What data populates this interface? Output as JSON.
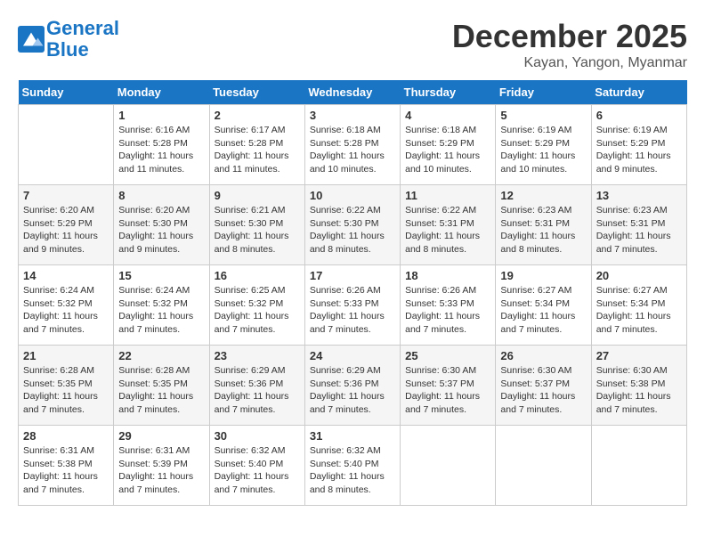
{
  "logo": {
    "line1": "General",
    "line2": "Blue"
  },
  "title": "December 2025",
  "location": "Kayan, Yangon, Myanmar",
  "headers": [
    "Sunday",
    "Monday",
    "Tuesday",
    "Wednesday",
    "Thursday",
    "Friday",
    "Saturday"
  ],
  "weeks": [
    [
      {
        "day": "",
        "info": ""
      },
      {
        "day": "1",
        "info": "Sunrise: 6:16 AM\nSunset: 5:28 PM\nDaylight: 11 hours\nand 11 minutes."
      },
      {
        "day": "2",
        "info": "Sunrise: 6:17 AM\nSunset: 5:28 PM\nDaylight: 11 hours\nand 11 minutes."
      },
      {
        "day": "3",
        "info": "Sunrise: 6:18 AM\nSunset: 5:28 PM\nDaylight: 11 hours\nand 10 minutes."
      },
      {
        "day": "4",
        "info": "Sunrise: 6:18 AM\nSunset: 5:29 PM\nDaylight: 11 hours\nand 10 minutes."
      },
      {
        "day": "5",
        "info": "Sunrise: 6:19 AM\nSunset: 5:29 PM\nDaylight: 11 hours\nand 10 minutes."
      },
      {
        "day": "6",
        "info": "Sunrise: 6:19 AM\nSunset: 5:29 PM\nDaylight: 11 hours\nand 9 minutes."
      }
    ],
    [
      {
        "day": "7",
        "info": "Sunrise: 6:20 AM\nSunset: 5:29 PM\nDaylight: 11 hours\nand 9 minutes."
      },
      {
        "day": "8",
        "info": "Sunrise: 6:20 AM\nSunset: 5:30 PM\nDaylight: 11 hours\nand 9 minutes."
      },
      {
        "day": "9",
        "info": "Sunrise: 6:21 AM\nSunset: 5:30 PM\nDaylight: 11 hours\nand 8 minutes."
      },
      {
        "day": "10",
        "info": "Sunrise: 6:22 AM\nSunset: 5:30 PM\nDaylight: 11 hours\nand 8 minutes."
      },
      {
        "day": "11",
        "info": "Sunrise: 6:22 AM\nSunset: 5:31 PM\nDaylight: 11 hours\nand 8 minutes."
      },
      {
        "day": "12",
        "info": "Sunrise: 6:23 AM\nSunset: 5:31 PM\nDaylight: 11 hours\nand 8 minutes."
      },
      {
        "day": "13",
        "info": "Sunrise: 6:23 AM\nSunset: 5:31 PM\nDaylight: 11 hours\nand 7 minutes."
      }
    ],
    [
      {
        "day": "14",
        "info": "Sunrise: 6:24 AM\nSunset: 5:32 PM\nDaylight: 11 hours\nand 7 minutes."
      },
      {
        "day": "15",
        "info": "Sunrise: 6:24 AM\nSunset: 5:32 PM\nDaylight: 11 hours\nand 7 minutes."
      },
      {
        "day": "16",
        "info": "Sunrise: 6:25 AM\nSunset: 5:32 PM\nDaylight: 11 hours\nand 7 minutes."
      },
      {
        "day": "17",
        "info": "Sunrise: 6:26 AM\nSunset: 5:33 PM\nDaylight: 11 hours\nand 7 minutes."
      },
      {
        "day": "18",
        "info": "Sunrise: 6:26 AM\nSunset: 5:33 PM\nDaylight: 11 hours\nand 7 minutes."
      },
      {
        "day": "19",
        "info": "Sunrise: 6:27 AM\nSunset: 5:34 PM\nDaylight: 11 hours\nand 7 minutes."
      },
      {
        "day": "20",
        "info": "Sunrise: 6:27 AM\nSunset: 5:34 PM\nDaylight: 11 hours\nand 7 minutes."
      }
    ],
    [
      {
        "day": "21",
        "info": "Sunrise: 6:28 AM\nSunset: 5:35 PM\nDaylight: 11 hours\nand 7 minutes."
      },
      {
        "day": "22",
        "info": "Sunrise: 6:28 AM\nSunset: 5:35 PM\nDaylight: 11 hours\nand 7 minutes."
      },
      {
        "day": "23",
        "info": "Sunrise: 6:29 AM\nSunset: 5:36 PM\nDaylight: 11 hours\nand 7 minutes."
      },
      {
        "day": "24",
        "info": "Sunrise: 6:29 AM\nSunset: 5:36 PM\nDaylight: 11 hours\nand 7 minutes."
      },
      {
        "day": "25",
        "info": "Sunrise: 6:30 AM\nSunset: 5:37 PM\nDaylight: 11 hours\nand 7 minutes."
      },
      {
        "day": "26",
        "info": "Sunrise: 6:30 AM\nSunset: 5:37 PM\nDaylight: 11 hours\nand 7 minutes."
      },
      {
        "day": "27",
        "info": "Sunrise: 6:30 AM\nSunset: 5:38 PM\nDaylight: 11 hours\nand 7 minutes."
      }
    ],
    [
      {
        "day": "28",
        "info": "Sunrise: 6:31 AM\nSunset: 5:38 PM\nDaylight: 11 hours\nand 7 minutes."
      },
      {
        "day": "29",
        "info": "Sunrise: 6:31 AM\nSunset: 5:39 PM\nDaylight: 11 hours\nand 7 minutes."
      },
      {
        "day": "30",
        "info": "Sunrise: 6:32 AM\nSunset: 5:40 PM\nDaylight: 11 hours\nand 7 minutes."
      },
      {
        "day": "31",
        "info": "Sunrise: 6:32 AM\nSunset: 5:40 PM\nDaylight: 11 hours\nand 8 minutes."
      },
      {
        "day": "",
        "info": ""
      },
      {
        "day": "",
        "info": ""
      },
      {
        "day": "",
        "info": ""
      }
    ]
  ]
}
